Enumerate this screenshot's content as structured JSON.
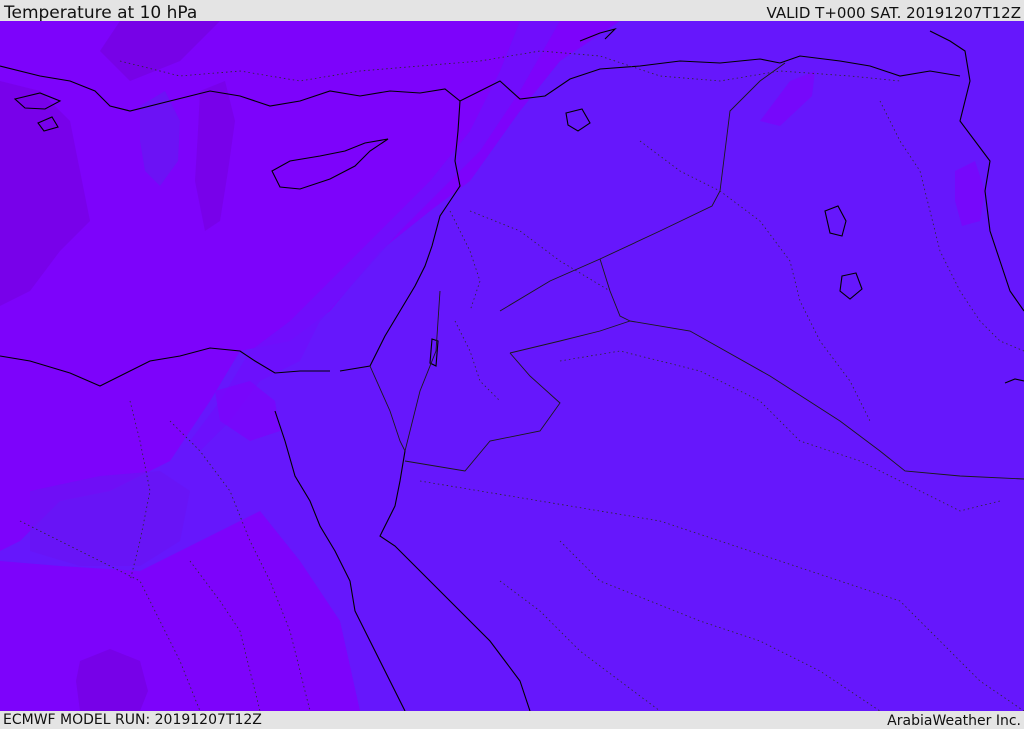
{
  "header": {
    "title": "Temperature at 10 hPa",
    "valid": "VALID T+000 SAT. 20191207T12Z"
  },
  "footer": {
    "model_run": "ECMWF MODEL RUN: 20191207T12Z",
    "credit": "ArabiaWeather Inc."
  },
  "map": {
    "variable": "temperature",
    "level": "10 hPa",
    "region": "Eastern Mediterranean and Middle East",
    "colors": {
      "east_field": "#6617fc",
      "west_field": "#7d03fb",
      "cold_patch": "#7602e2",
      "transition_band": "#6d0ffc",
      "warm_patch": "#6a14f4",
      "coastline": "#000000",
      "borders": "#1a1a1a"
    }
  }
}
